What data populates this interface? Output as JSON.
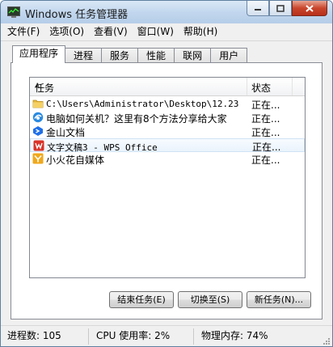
{
  "window": {
    "title": "Windows 任务管理器"
  },
  "menu": [
    "文件(F)",
    "选项(O)",
    "查看(V)",
    "窗口(W)",
    "帮助(H)"
  ],
  "tabs": [
    "应用程序",
    "进程",
    "服务",
    "性能",
    "联网",
    "用户"
  ],
  "active_tab": 0,
  "table": {
    "headers": {
      "task": "任务",
      "status": "状态"
    },
    "rows": [
      {
        "name": "C:\\Users\\Administrator\\Desktop\\12.23",
        "status": "正在...",
        "icon": "folder-icon"
      },
      {
        "name": "电脑如何关机？这里有8个方法分享给大家",
        "status": "正在...",
        "icon": "browser-icon"
      },
      {
        "name": "金山文档",
        "status": "正在...",
        "icon": "kdocs-icon"
      },
      {
        "name": "文字文稿3 - WPS Office",
        "status": "正在...",
        "icon": "wps-icon"
      },
      {
        "name": "小火花自媒体",
        "status": "正在...",
        "icon": "spark-icon"
      }
    ]
  },
  "buttons": {
    "end_task": "结束任务(E)",
    "switch_to": "切换至(S)",
    "new_task": "新任务(N)..."
  },
  "statusbar": {
    "processes": "进程数: 105",
    "cpu": "CPU 使用率: 2%",
    "memory": "物理内存: 74%"
  }
}
